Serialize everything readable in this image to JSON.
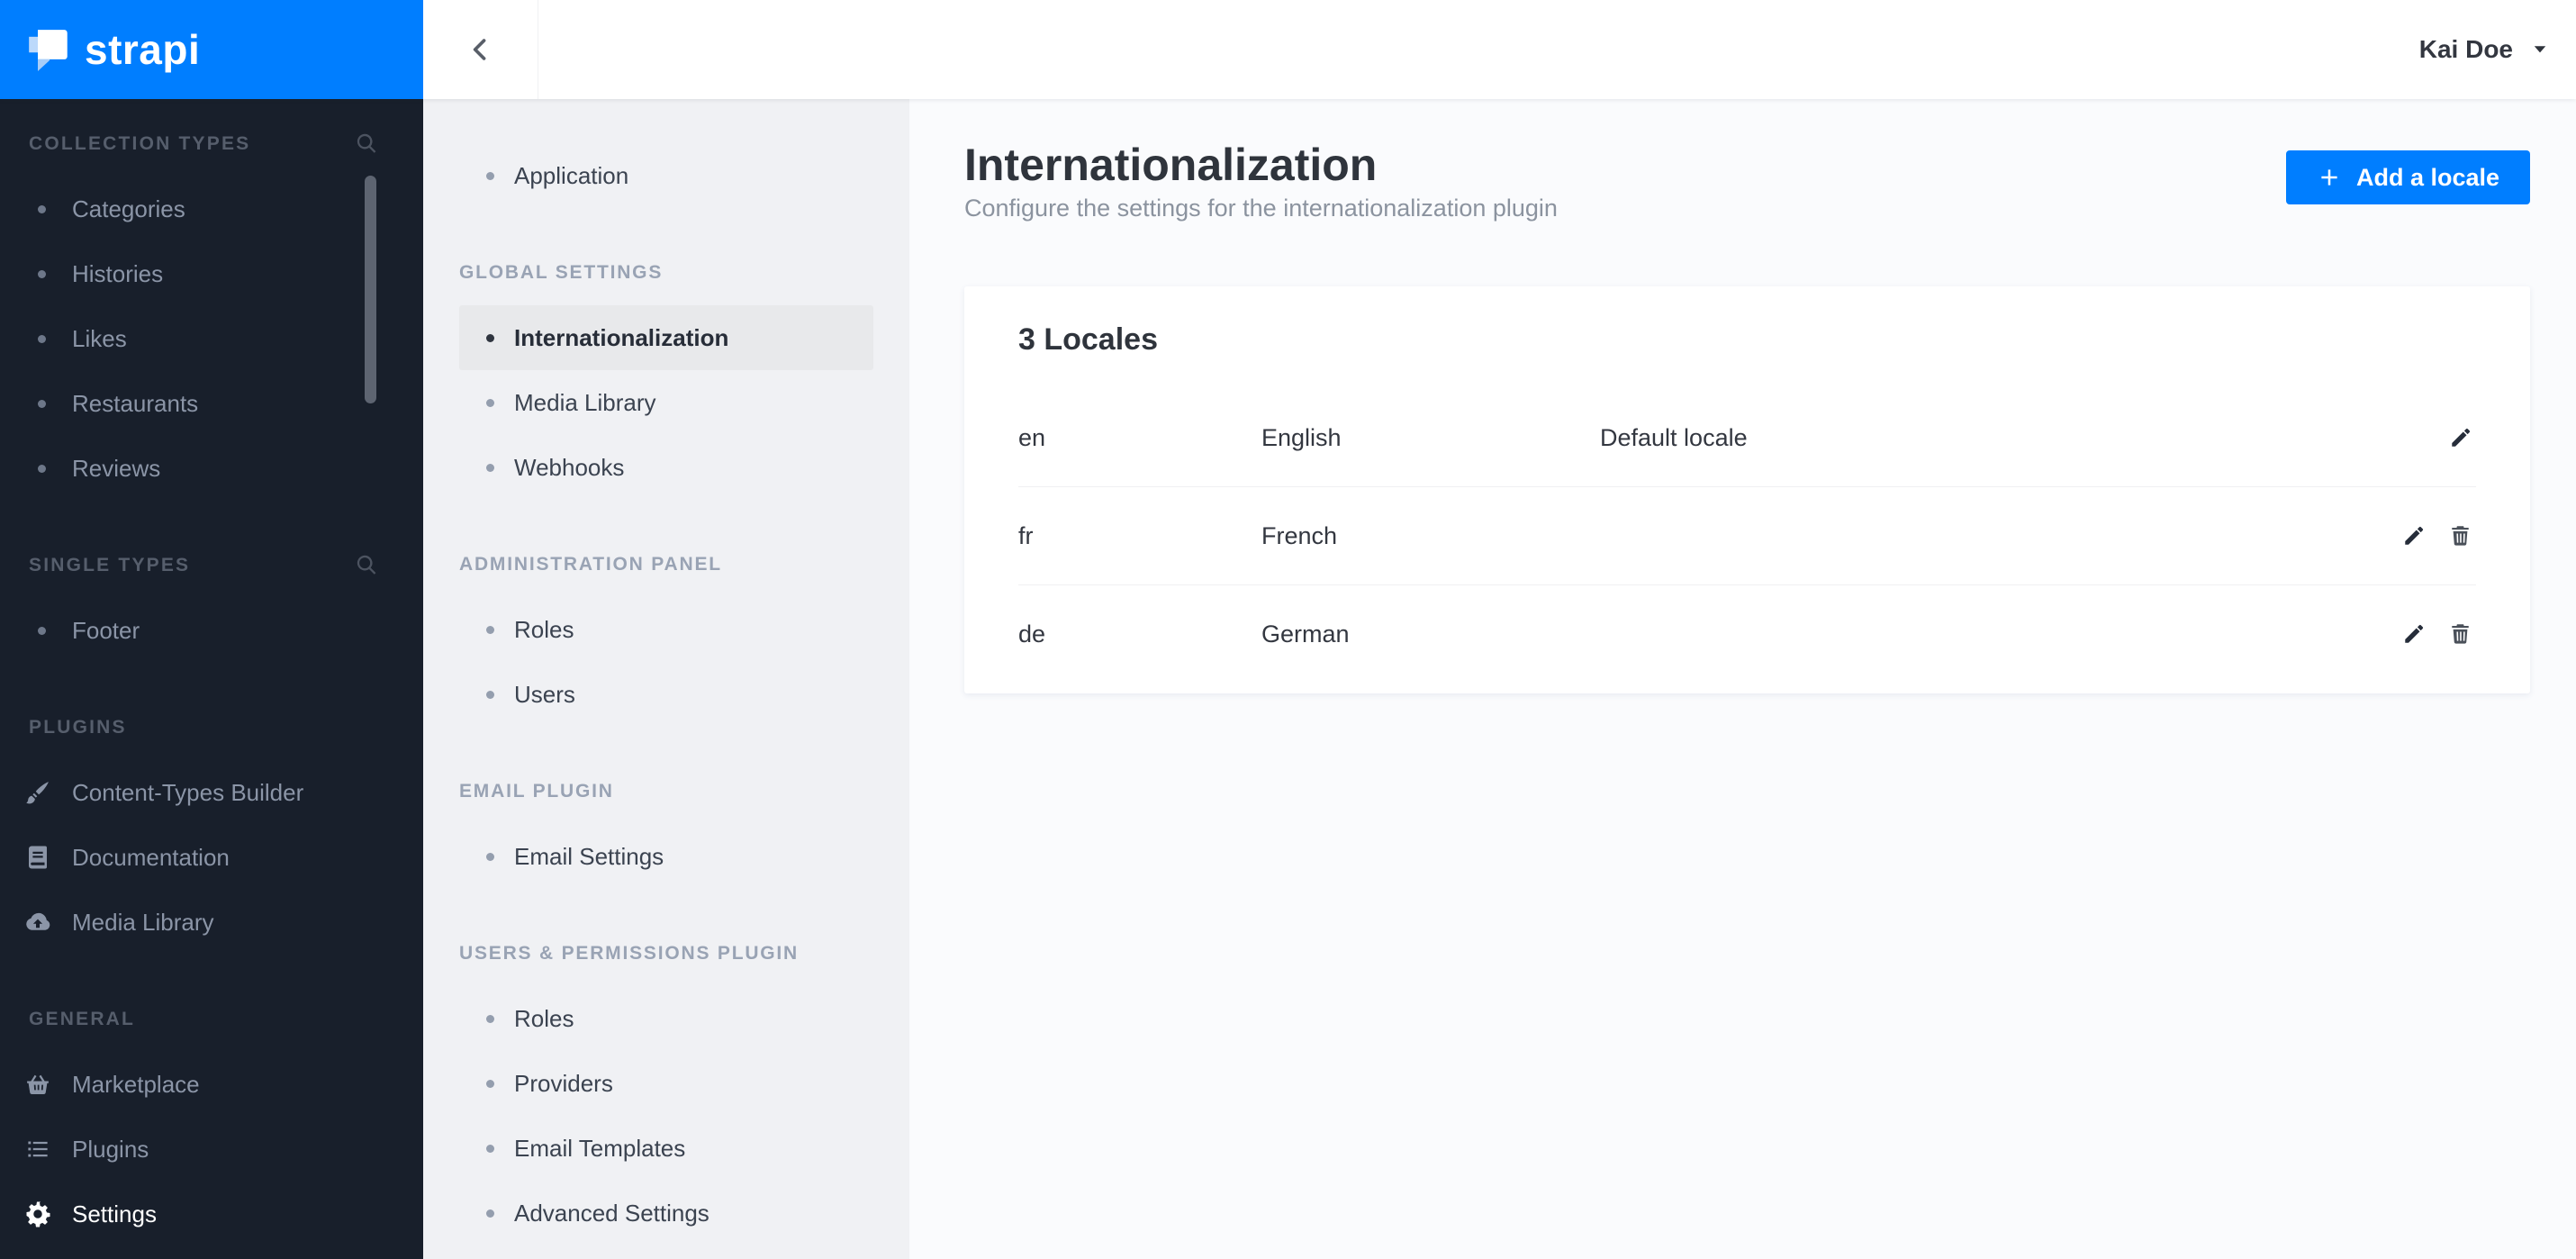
{
  "colors": {
    "primary": "#007eff",
    "main_sidebar_bg": "#181f2b",
    "settings_sidebar_bg": "#f0f1f4",
    "content_bg": "#fafbfd",
    "active_item_bg": "#e8e9eb"
  },
  "brand": {
    "logo_text": "strapi"
  },
  "header": {
    "user_name": "Kai Doe"
  },
  "left_sidebar": {
    "sections": [
      {
        "label": "COLLECTION TYPES",
        "has_search": true,
        "items": [
          {
            "label": "Categories"
          },
          {
            "label": "Histories"
          },
          {
            "label": "Likes"
          },
          {
            "label": "Restaurants"
          },
          {
            "label": "Reviews"
          }
        ]
      },
      {
        "label": "SINGLE TYPES",
        "has_search": true,
        "items": [
          {
            "label": "Footer"
          }
        ]
      },
      {
        "label": "PLUGINS",
        "has_search": false,
        "items": [
          {
            "label": "Content-Types Builder",
            "icon": "paintbrush-icon"
          },
          {
            "label": "Documentation",
            "icon": "book-icon"
          },
          {
            "label": "Media Library",
            "icon": "cloud-upload-icon"
          }
        ]
      },
      {
        "label": "GENERAL",
        "has_search": false,
        "items": [
          {
            "label": "Marketplace",
            "icon": "basket-icon"
          },
          {
            "label": "Plugins",
            "icon": "list-icon"
          },
          {
            "label": "Settings",
            "icon": "gear-icon",
            "active": true
          }
        ]
      }
    ]
  },
  "settings_sidebar": {
    "top_items": [
      {
        "label": "Application"
      }
    ],
    "sections": [
      {
        "label": "GLOBAL SETTINGS",
        "items": [
          {
            "label": "Internationalization",
            "active": true
          },
          {
            "label": "Media Library"
          },
          {
            "label": "Webhooks"
          }
        ]
      },
      {
        "label": "ADMINISTRATION PANEL",
        "items": [
          {
            "label": "Roles"
          },
          {
            "label": "Users"
          }
        ]
      },
      {
        "label": "EMAIL PLUGIN",
        "items": [
          {
            "label": "Email Settings"
          }
        ]
      },
      {
        "label": "USERS & PERMISSIONS PLUGIN",
        "items": [
          {
            "label": "Roles"
          },
          {
            "label": "Providers"
          },
          {
            "label": "Email Templates"
          },
          {
            "label": "Advanced Settings"
          }
        ]
      }
    ]
  },
  "main": {
    "title": "Internationalization",
    "subtitle": "Configure the settings for the internationalization plugin",
    "add_button_label": "Add a locale",
    "locales": {
      "heading": "3 Locales",
      "rows": [
        {
          "code": "en",
          "name": "English",
          "note": "Default locale",
          "can_delete": false
        },
        {
          "code": "fr",
          "name": "French",
          "note": "",
          "can_delete": true
        },
        {
          "code": "de",
          "name": "German",
          "note": "",
          "can_delete": true
        }
      ]
    }
  }
}
